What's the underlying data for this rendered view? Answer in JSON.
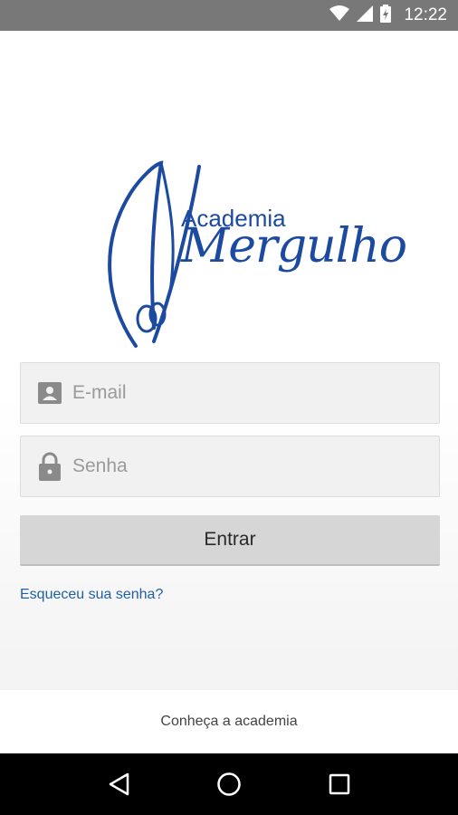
{
  "status_bar": {
    "time": "12:22"
  },
  "logo": {
    "line1": "Academia",
    "line2": "Mergulho"
  },
  "email": {
    "placeholder": "E-mail",
    "icon": "contact-card-icon"
  },
  "password": {
    "placeholder": "Senha",
    "icon": "lock-icon"
  },
  "login_button": {
    "label": "Entrar"
  },
  "forgot_password": {
    "label": "Esqueceu sua senha?"
  },
  "about": {
    "label": "Conheça a academia"
  },
  "nav": {
    "back_icon": "back-icon",
    "home_icon": "home-icon",
    "recents_icon": "recents-icon"
  },
  "colors": {
    "brand": "#1c4aa0",
    "link": "#1f5fa8",
    "button": "#d6d6d6"
  }
}
